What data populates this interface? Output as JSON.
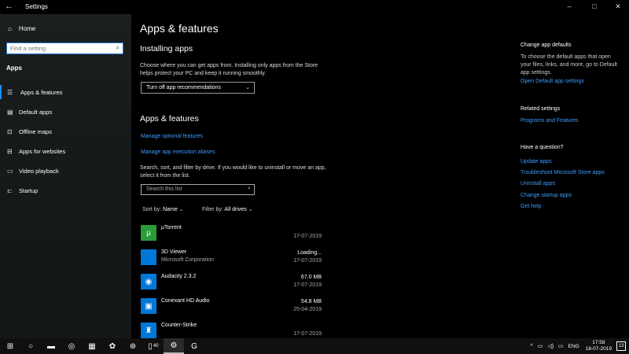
{
  "window": {
    "title": "Settings",
    "back_glyph": "←",
    "minimize": "–",
    "maximize": "□",
    "close": "✕"
  },
  "sidebar": {
    "home_label": "Home",
    "search_placeholder": "Find a setting",
    "section_title": "Apps",
    "items": [
      {
        "label": "Apps & features",
        "icon": "apps-features-icon",
        "glyph": "☰",
        "active": true
      },
      {
        "label": "Default apps",
        "icon": "default-apps-icon",
        "glyph": "▤"
      },
      {
        "label": "Offline maps",
        "icon": "offline-maps-icon",
        "glyph": "⊡"
      },
      {
        "label": "Apps for websites",
        "icon": "apps-websites-icon",
        "glyph": "⊟"
      },
      {
        "label": "Video playback",
        "icon": "video-playback-icon",
        "glyph": "▭"
      },
      {
        "label": "Startup",
        "icon": "startup-icon",
        "glyph": "⊏"
      }
    ]
  },
  "main": {
    "title": "Apps & features",
    "installing": {
      "heading": "Installing apps",
      "description": "Choose where you can get apps from. Installing only apps from the Store helps protect your PC and keep it running smoothly.",
      "select_value": "Turn off app recommendations"
    },
    "apps_features": {
      "heading": "Apps & features",
      "link_optional": "Manage optional features",
      "link_aliases": "Manage app execution aliases",
      "filter_description": "Search, sort, and filter by drive. If you would like to uninstall or move an app, select it from the list.",
      "search_placeholder": "Search this list",
      "sort_label": "Sort by:",
      "sort_value": "Name",
      "filter_label": "Filter by:",
      "filter_value": "All drives"
    },
    "apps": [
      {
        "name": "µTorrent",
        "publisher": "",
        "size": "",
        "date": "17-07-2019",
        "icon": "utorrent-icon",
        "glyph": "µ",
        "color": "#2a9a3a"
      },
      {
        "name": "3D Viewer",
        "publisher": "Microsoft Corporation",
        "size": "Loading...",
        "date": "17-07-2019",
        "icon": "3d-viewer-icon",
        "glyph": "",
        "color": "#0078d7"
      },
      {
        "name": "Audacity 2.3.2",
        "publisher": "",
        "size": "67.0 MB",
        "date": "17-07-2019",
        "icon": "audacity-icon",
        "glyph": "◉",
        "color": "#0078d7"
      },
      {
        "name": "Conexant HD Audio",
        "publisher": "",
        "size": "54.8 MB",
        "date": "25-04-2019",
        "icon": "conexant-audio-icon",
        "glyph": "▣",
        "color": "#0078d7"
      },
      {
        "name": "Counter-Strike",
        "publisher": "",
        "size": "",
        "date": "17-07-2019",
        "icon": "counter-strike-icon",
        "glyph": "♜",
        "color": "#0078d7"
      }
    ]
  },
  "right": {
    "defaults_heading": "Change app defaults",
    "defaults_text": "To choose the default apps that open your files, links, and more, go to Default app settings.",
    "defaults_link": "Open Default app settings",
    "related_heading": "Related settings",
    "related_link": "Programs and Features",
    "question_heading": "Have a question?",
    "links": [
      "Update apps",
      "Troubleshoot Microsoft Store apps",
      "Uninstall apps",
      "Change startup apps",
      "Get help"
    ]
  },
  "taskbar": {
    "buttons": [
      {
        "name": "start-icon",
        "glyph": "⊞"
      },
      {
        "name": "cortana-icon",
        "glyph": "○"
      },
      {
        "name": "file-explorer-icon",
        "glyph": "▬"
      },
      {
        "name": "chrome-icon",
        "glyph": "◎"
      },
      {
        "name": "media-app-icon",
        "glyph": "▦"
      },
      {
        "name": "app-icon",
        "glyph": "✿"
      },
      {
        "name": "steam-icon",
        "glyph": "⊛"
      },
      {
        "name": "badge-app-icon",
        "glyph": "▯",
        "badge": "40"
      },
      {
        "name": "settings-icon",
        "glyph": "⚙",
        "active": true
      },
      {
        "name": "logitech-icon",
        "glyph": "G"
      }
    ],
    "tray_up": "^",
    "tray_net": "▭",
    "tray_vol": "◁)",
    "tray_usb": "▭",
    "language": "ENG",
    "time": "17:58",
    "date": "18-07-2019",
    "notifications": "13"
  }
}
